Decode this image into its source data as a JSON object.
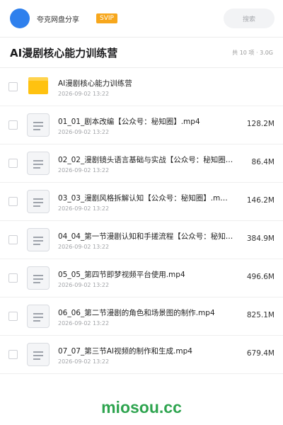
{
  "header": {
    "app_name": "夸克网盘分享",
    "badge": "SVIP",
    "search_placeholder": "搜索"
  },
  "folder": {
    "title": "AI漫剧核心能力训练营",
    "meta": "共 10 项 · 3.0G"
  },
  "items": [
    {
      "type": "folder",
      "name": "AI漫剧核心能力训练营",
      "date": "2026-09-02 13:22",
      "size": ""
    },
    {
      "type": "file",
      "name": "01_01_剧本改编【公众号：秘知圈】.mp4",
      "date": "2026-09-02 13:22",
      "size": "128.2M"
    },
    {
      "type": "file",
      "name": "02_02_漫剧镜头语言基础与实战【公众号：秘知圈…",
      "date": "2026-09-02 13:22",
      "size": "86.4M"
    },
    {
      "type": "file",
      "name": "03_03_漫剧风格拆解认知【公众号：秘知圈】.m…",
      "date": "2026-09-02 13:22",
      "size": "146.2M"
    },
    {
      "type": "file",
      "name": "04_04_第一节漫剧认知和手搓流程【公众号：秘知…",
      "date": "2026-09-02 13:22",
      "size": "384.9M"
    },
    {
      "type": "file",
      "name": "05_05_第四节即梦视频平台使用.mp4",
      "date": "2026-09-02 13:22",
      "size": "496.6M"
    },
    {
      "type": "file",
      "name": "06_06_第二节漫剧的角色和场景图的制作.mp4",
      "date": "2026-09-02 13:22",
      "size": "825.1M"
    },
    {
      "type": "file",
      "name": "07_07_第三节AI视频的制作和生成.mp4",
      "date": "2026-09-02 13:22",
      "size": "679.4M"
    }
  ],
  "icons": {
    "folder": "folder-icon",
    "file": "document-icon",
    "checkbox": "checkbox-icon"
  },
  "colors": {
    "avatar": "#2f80ed",
    "badge": "#f7a71c",
    "folder": "#ffc210",
    "watermark": "#2ea44f"
  },
  "watermark": "miosou.cc"
}
